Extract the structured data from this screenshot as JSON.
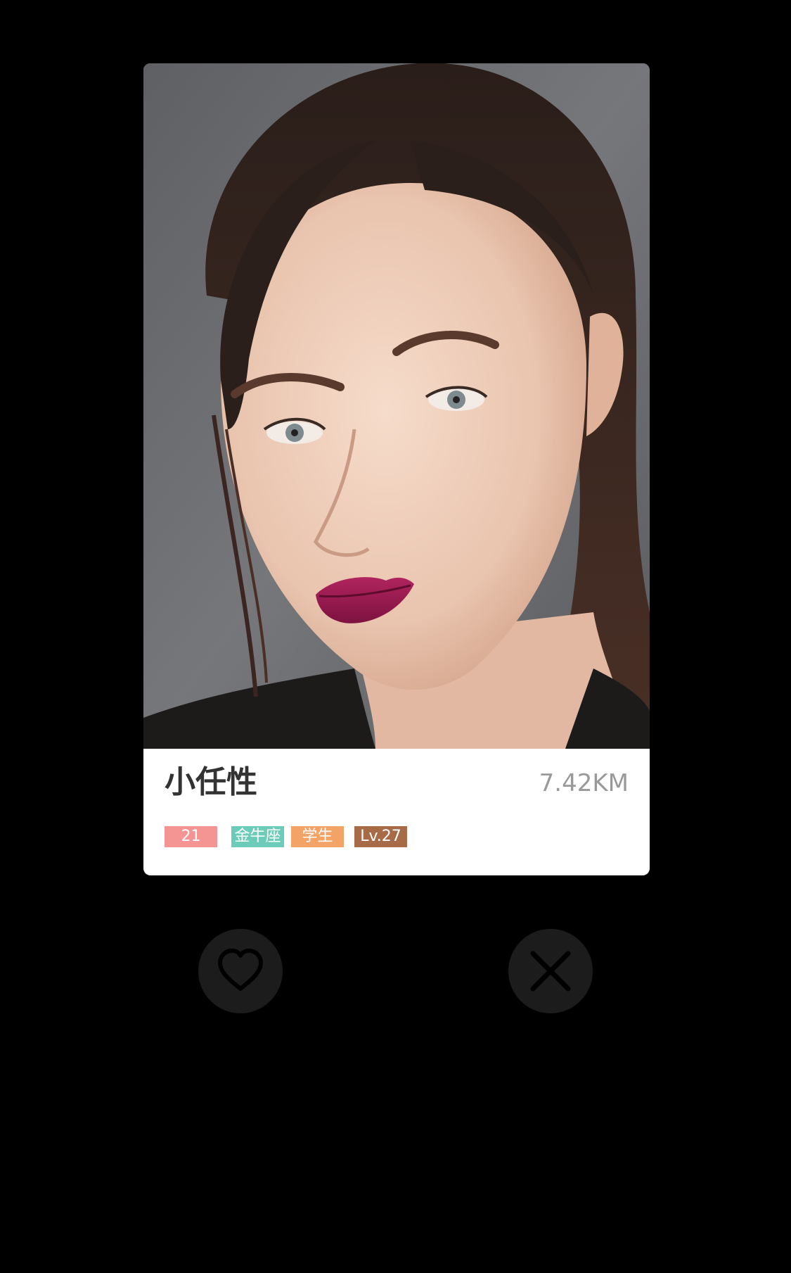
{
  "profile": {
    "name": "小任性",
    "distance": "7.42KM",
    "tags": {
      "age": "21",
      "zodiac": "金牛座",
      "occupation": "学生",
      "level": "Lv.27"
    }
  },
  "colors": {
    "age_tag": "#F59593",
    "zodiac_tag": "#6BCCB9",
    "occupation_tag": "#F3A365",
    "level_tag": "#A86B47",
    "background": "#000000",
    "action_button": "#1C1C1C",
    "action_icon": "#000000"
  },
  "icons": {
    "like": "heart-icon",
    "dislike": "close-icon"
  }
}
